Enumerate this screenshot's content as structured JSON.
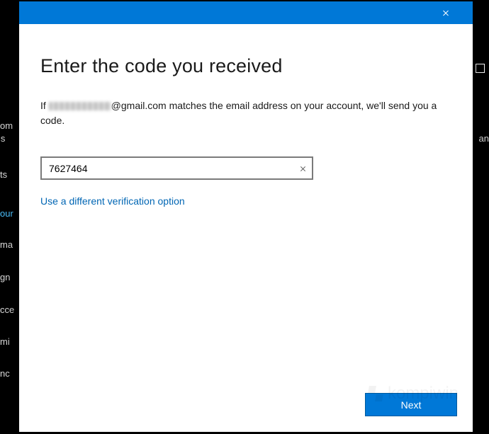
{
  "bg": {
    "items": [
      "om",
      "a s",
      "ts",
      "our",
      "ma",
      "gn",
      "cce",
      "mi",
      "nc"
    ],
    "rightText": "an"
  },
  "dialog": {
    "title": "Enter the code you received",
    "description_prefix": "If ",
    "description_email_suffix": "@gmail.com matches the email address on your account, we'll send you a code.",
    "code_value": "7627464",
    "alt_link": "Use a different verification option",
    "next_label": "Next"
  },
  "watermark": "kompiwin"
}
